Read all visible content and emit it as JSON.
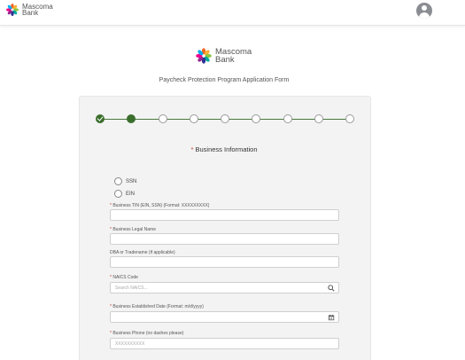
{
  "brand": {
    "name_line1": "Mascoma",
    "name_line2": "Bank",
    "petal_colors": [
      "#f26522",
      "#fbb034",
      "#8dc63f",
      "#00a99d",
      "#2e3192",
      "#92278f",
      "#ec008c",
      "#00aeef"
    ]
  },
  "header": {
    "avatar_icon": "user-avatar-icon"
  },
  "form": {
    "title": "Paycheck Protection Program Application Form",
    "progress": {
      "total_steps": 9,
      "completed_steps": 1,
      "current_step": 2
    },
    "section_title": "Business Information",
    "section_required_mark": "*",
    "tin_type_options": [
      "SSN",
      "EIN"
    ],
    "fields": {
      "tin": {
        "label": "Business TIN (EIN, SSN) (Format: XXXXXXXXX)",
        "required": "*",
        "value": ""
      },
      "legal_name": {
        "label": "Business Legal Name",
        "required": "*",
        "value": ""
      },
      "dba": {
        "label": "DBA or Tradename (if applicable)",
        "value": ""
      },
      "naics": {
        "label": "NAICS Code",
        "required": "*",
        "placeholder": "Search NAICS...",
        "icon": "search-icon"
      },
      "established": {
        "label": "Business Established Date (Format: m/d/yyyy)",
        "required": "*",
        "icon": "calendar-icon"
      },
      "phone": {
        "label": "Business Phone (no dashes please)",
        "required": "*",
        "placeholder": "XXXXXXXXXX"
      }
    }
  },
  "colors": {
    "progress_green": "#3a6e2c",
    "required_red": "#c23934"
  }
}
